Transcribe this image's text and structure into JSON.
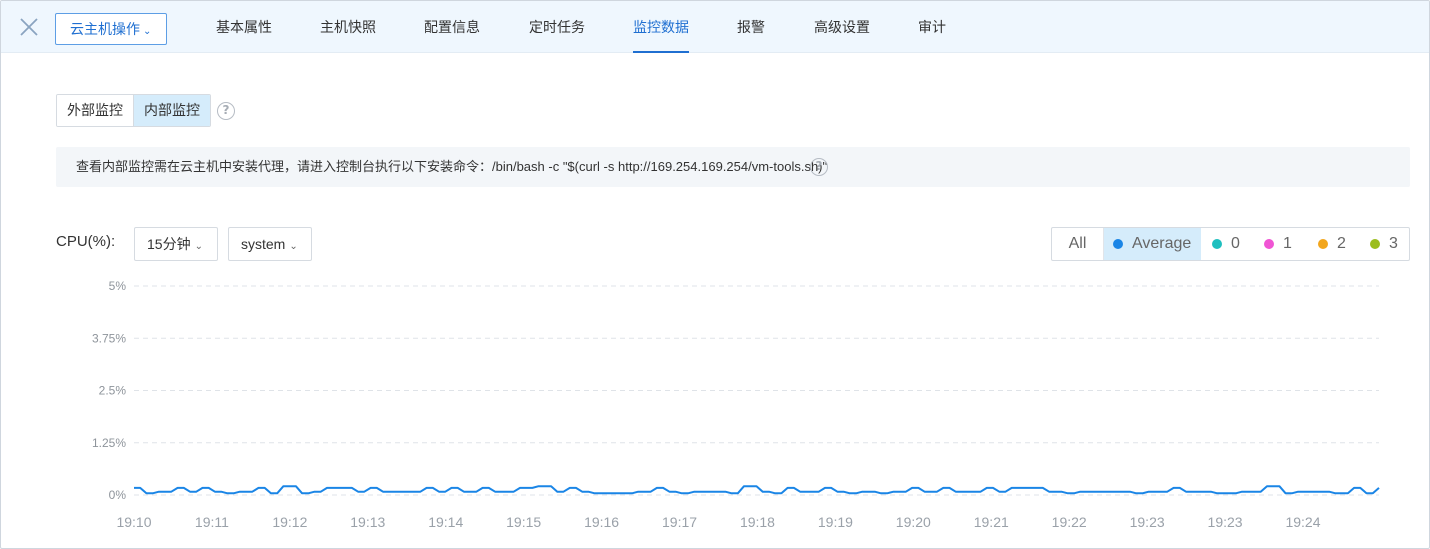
{
  "header": {
    "action_button": "云主机操作",
    "tabs": [
      {
        "label": "基本属性",
        "active": false
      },
      {
        "label": "主机快照",
        "active": false
      },
      {
        "label": "配置信息",
        "active": false
      },
      {
        "label": "定时任务",
        "active": false
      },
      {
        "label": "监控数据",
        "active": true
      },
      {
        "label": "报警",
        "active": false
      },
      {
        "label": "高级设置",
        "active": false
      },
      {
        "label": "审计",
        "active": false
      }
    ]
  },
  "monitor_toggle": {
    "external": "外部监控",
    "internal": "内部监控",
    "selected": "内部监控"
  },
  "notice": {
    "text": "查看内部监控需在云主机中安装代理，请进入控制台执行以下安装命令：/bin/bash -c \"$(curl -s http://169.254.169.254/vm-tools.sh)\""
  },
  "chart_controls": {
    "metric_label": "CPU(%):",
    "time_range": "15分钟",
    "cpu_type": "system"
  },
  "legend": {
    "all_label": "All",
    "items": [
      {
        "label": "Average",
        "color": "#1a85e6",
        "selected": true
      },
      {
        "label": "0",
        "color": "#1fbfbf",
        "selected": false
      },
      {
        "label": "1",
        "color": "#f055d4",
        "selected": false
      },
      {
        "label": "2",
        "color": "#f2a61d",
        "selected": false
      },
      {
        "label": "3",
        "color": "#9bbd1c",
        "selected": false
      }
    ]
  },
  "colors": {
    "accent": "#1f6fd1",
    "line": "#1a85e6",
    "grid": "#dfe3e8"
  },
  "chart_data": {
    "type": "line",
    "title": "",
    "ylabel": "",
    "xlabel": "",
    "y_ticks": [
      "0%",
      "1.25%",
      "2.5%",
      "3.75%",
      "5%"
    ],
    "ylim": [
      0,
      5
    ],
    "x_tick_labels": [
      "19:10",
      "19:11",
      "19:12",
      "19:13",
      "19:14",
      "19:15",
      "19:16",
      "19:17",
      "19:18",
      "19:19",
      "19:20",
      "19:21",
      "19:22",
      "19:23",
      "19:23",
      "19:24"
    ],
    "grid": "horizontal-dashed",
    "series": [
      {
        "name": "Average",
        "color": "#1a85e6",
        "values": [
          0.17,
          0.17,
          0.04,
          0.04,
          0.08,
          0.08,
          0.08,
          0.17,
          0.17,
          0.08,
          0.08,
          0.17,
          0.17,
          0.08,
          0.08,
          0.04,
          0.04,
          0.08,
          0.08,
          0.08,
          0.17,
          0.17,
          0.04,
          0.04,
          0.21,
          0.21,
          0.21,
          0.04,
          0.04,
          0.08,
          0.08,
          0.17,
          0.17,
          0.17,
          0.17,
          0.17,
          0.08,
          0.08,
          0.17,
          0.17,
          0.08,
          0.08,
          0.08,
          0.08,
          0.08,
          0.08,
          0.08,
          0.17,
          0.17,
          0.08,
          0.08,
          0.17,
          0.17,
          0.08,
          0.08,
          0.08,
          0.17,
          0.17,
          0.08,
          0.08,
          0.08,
          0.08,
          0.17,
          0.17,
          0.17,
          0.21,
          0.21,
          0.21,
          0.08,
          0.08,
          0.17,
          0.17,
          0.08,
          0.08,
          0.04,
          0.04,
          0.04,
          0.04,
          0.04,
          0.04,
          0.04,
          0.08,
          0.08,
          0.08,
          0.17,
          0.17,
          0.08,
          0.08,
          0.04,
          0.04,
          0.08,
          0.08,
          0.08,
          0.08,
          0.08,
          0.08,
          0.04,
          0.04,
          0.21,
          0.21,
          0.21,
          0.08,
          0.08,
          0.04,
          0.04,
          0.17,
          0.17,
          0.08,
          0.08,
          0.08,
          0.08,
          0.17,
          0.17,
          0.08,
          0.08,
          0.04,
          0.04,
          0.08,
          0.08,
          0.08,
          0.04,
          0.04,
          0.08,
          0.08,
          0.08,
          0.17,
          0.17,
          0.08,
          0.08,
          0.08,
          0.17,
          0.17,
          0.08,
          0.08,
          0.08,
          0.08,
          0.08,
          0.17,
          0.17,
          0.08,
          0.08,
          0.17,
          0.17,
          0.17,
          0.17,
          0.17,
          0.17,
          0.08,
          0.08,
          0.08,
          0.04,
          0.04,
          0.08,
          0.08,
          0.08,
          0.08,
          0.08,
          0.08,
          0.08,
          0.08,
          0.08,
          0.04,
          0.04,
          0.08,
          0.08,
          0.08,
          0.08,
          0.17,
          0.17,
          0.08,
          0.08,
          0.08,
          0.08,
          0.08,
          0.04,
          0.04,
          0.04,
          0.04,
          0.08,
          0.08,
          0.08,
          0.08,
          0.21,
          0.21,
          0.21,
          0.04,
          0.04,
          0.08,
          0.08,
          0.08,
          0.08,
          0.08,
          0.08,
          0.04,
          0.04,
          0.04,
          0.17,
          0.17,
          0.04,
          0.04,
          0.17
        ]
      }
    ]
  }
}
